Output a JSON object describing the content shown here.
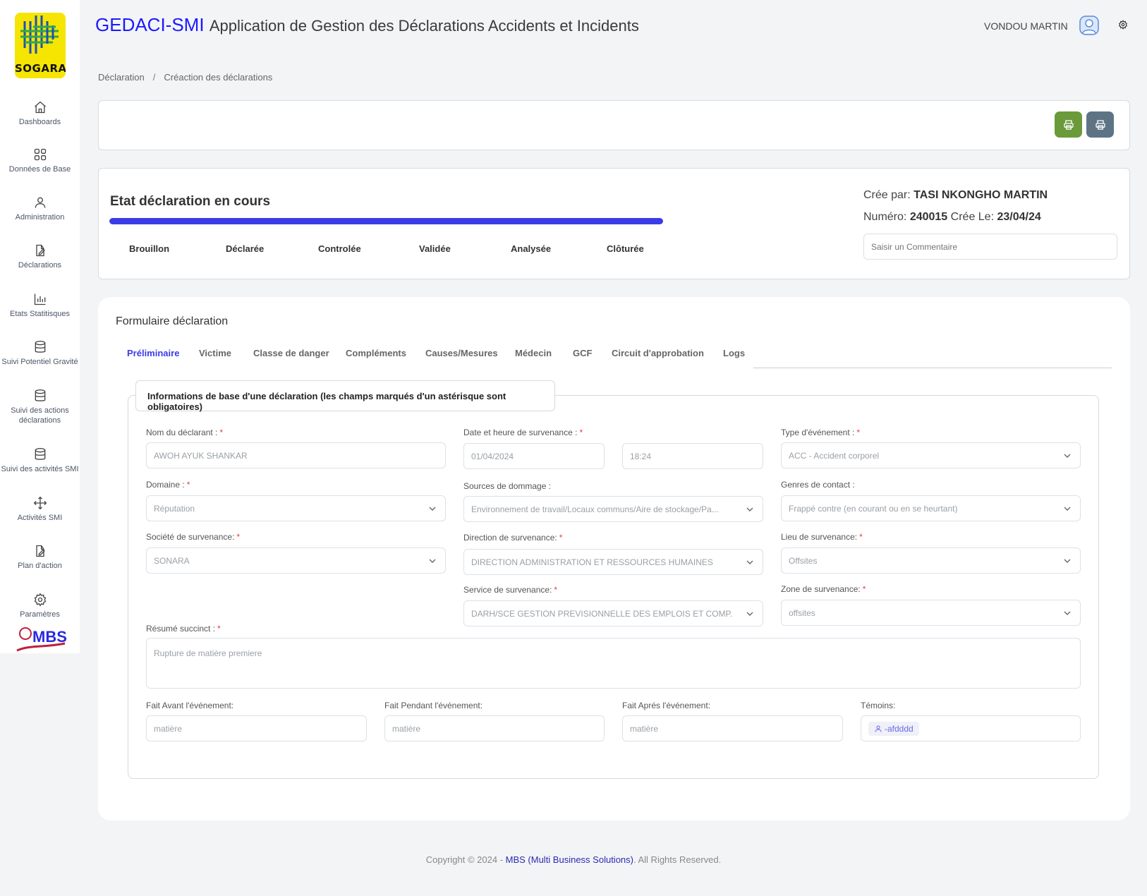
{
  "app": {
    "logo_text": "SOGARA",
    "title": "GEDACI-SMI",
    "subtitle": "Application de Gestion des Déclarations Accidents et Incidents",
    "user_name": "VONDOU MARTIN",
    "mbs_logo_text": "MBS"
  },
  "sidebar": {
    "items": [
      {
        "label": "Dashboards",
        "icon": "home-icon"
      },
      {
        "label": "Données de Base",
        "icon": "grid-icon"
      },
      {
        "label": "Administration",
        "icon": "user-icon"
      },
      {
        "label": "Déclarations",
        "icon": "edit-file-icon"
      },
      {
        "label": "Etats Statitisques",
        "icon": "bar-chart-icon"
      },
      {
        "label": "Suivi Potentiel Gravité",
        "icon": "database-icon"
      },
      {
        "label": "Suivi des actions déclarations",
        "icon": "database-icon"
      },
      {
        "label": "Suivi des activités SMI",
        "icon": "database-icon"
      },
      {
        "label": "Activités SMI",
        "icon": "move-icon"
      },
      {
        "label": "Plan d'action",
        "icon": "edit-file-icon"
      },
      {
        "label": "Paramètres",
        "icon": "gear-icon"
      }
    ]
  },
  "breadcrumb": {
    "root": "Déclaration",
    "sep": "/",
    "current": "Créaction des déclarations"
  },
  "state": {
    "title": "Etat déclaration en cours",
    "progress_fraction": 1.0,
    "steps": [
      "Brouillon",
      "Déclarée",
      "Controlée",
      "Validée",
      "Analysée",
      "Clôturée"
    ],
    "created_by_label": "Crée par:",
    "created_by": "TASI NKONGHO MARTIN",
    "number_label": "Numéro:",
    "number": "240015",
    "created_on_label": "Crée Le:",
    "created_on": "23/04/24",
    "comment_placeholder": "Saisir un Commentaire"
  },
  "form": {
    "title": "Formulaire déclaration",
    "tabs": [
      "Préliminaire",
      "Victime",
      "Classe de danger",
      "Compléments",
      "Causes/Mesures",
      "Médecin",
      "GCF",
      "Circuit d'approbation",
      "Logs"
    ],
    "legend": "Informations de base d'une déclaration (les champs marqués d'un astérisque sont obligatoires)",
    "fields": {
      "declarant_label": "Nom du déclarant :",
      "declarant_value": "AWOH  AYUK SHANKAR",
      "date_label": "Date et heure de survenance :",
      "date_value": "01/04/2024",
      "time_value": "18:24",
      "type_label": "Type d'événement :",
      "type_value": "ACC - Accident corporel",
      "domaine_label": "Domaine :",
      "domaine_value": "Réputation",
      "sources_label": "Sources de dommage :",
      "sources_value": "Environnement de travail/Locaux communs/Aire de stockage/Pa...",
      "genres_label": "Genres de contact :",
      "genres_value": "Frappé contre (en courant ou en se heurtant)",
      "societe_label": "Société de survenance:",
      "societe_value": "SONARA",
      "direction_label": "Direction de survenance:",
      "direction_value": "DIRECTION ADMINISTRATION ET RESSOURCES HUMAINES",
      "lieu_label": "Lieu de survenance:",
      "lieu_value": "Offsites",
      "service_label": "Service de survenance:",
      "service_value": "DARH/SCE GESTION PREVISIONNELLE DES EMPLOIS ET COMP.",
      "zone_label": "Zone de survenance:",
      "zone_value": "offsites",
      "resume_label": "Résumé succinct :",
      "resume_value": "Rupture de matière premiere",
      "avant_label": "Fait Avant l'événement:",
      "avant_value": "matière",
      "pendant_label": "Fait Pendant l'événement:",
      "pendant_value": "matière",
      "apres_label": "Fait Aprés l'événement:",
      "apres_value": "matière",
      "temoins_label": "Témoins:",
      "temoins_value": "-afdddd"
    },
    "required_mark": "*"
  },
  "footer": {
    "prefix": "Copyright © 2024 - ",
    "company": "MBS (Multi Business Solutions)",
    "suffix": ". All Rights Reserved."
  },
  "colors": {
    "accent": "#3b3be8",
    "print_green": "#6a9a3a",
    "print_grey": "#5e7485",
    "required": "#e53e3e"
  }
}
